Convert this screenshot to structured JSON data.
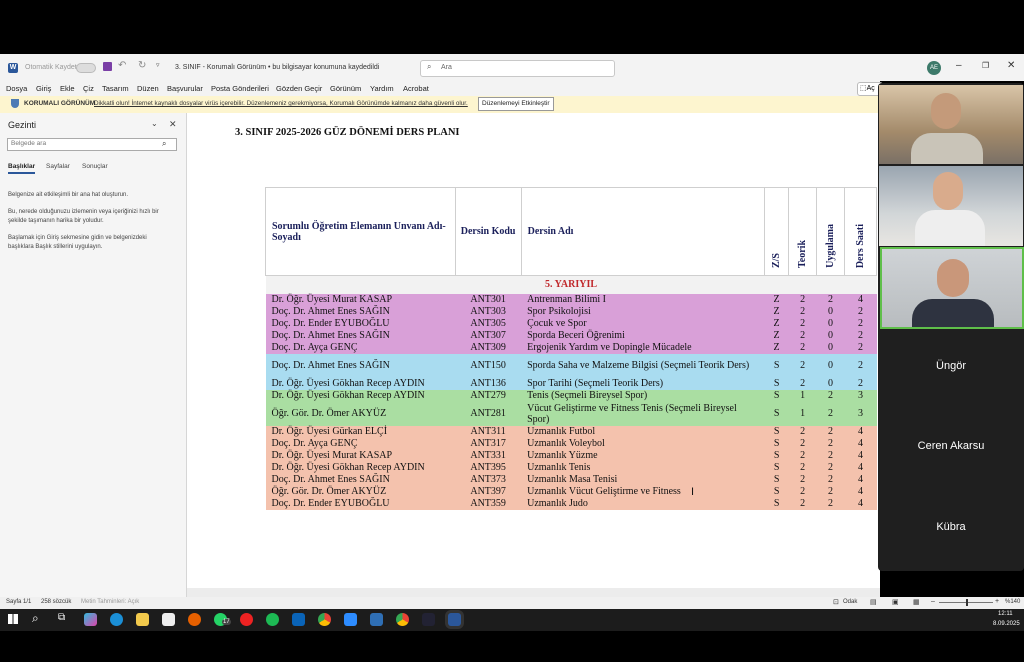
{
  "window": {
    "autosave_label": "Otomatik Kaydet",
    "doc_title": "3. SINIF - Korumalı Görünüm • bu bilgisayar konumuna kaydedildi",
    "search_placeholder": "Ara",
    "avatar_initials": "AE",
    "share_partial": "Aç"
  },
  "menu": [
    "Dosya",
    "Giriş",
    "Ekle",
    "Çiz",
    "Tasarım",
    "Düzen",
    "Başvurular",
    "Posta Gönderileri",
    "Gözden Geçir",
    "Görünüm",
    "Yardım",
    "Acrobat"
  ],
  "banner": {
    "label": "KORUMALI GÖRÜNÜM",
    "message": "Dikkatli olun! İnternet kaynaklı dosyalar virüs içerebilir. Düzenlemeniz gerekmiyorsa, Korumalı Görünümde kalmanız daha güvenli olur.",
    "button": "Düzenlemeyi Etkinleştir"
  },
  "nav": {
    "title": "Gezinti",
    "search_placeholder": "Belgede ara",
    "tabs": [
      "Başlıklar",
      "Sayfalar",
      "Sonuçlar"
    ],
    "p1": "Belgenize ait etkileşimli bir ana hat oluşturun.",
    "p2": "Bu, nerede olduğunuzu izlemenin veya içeriğinizi hızlı bir şekilde taşımanın harika bir yoludur.",
    "p3": "Başlamak için Giriş sekmesine gidin ve belgenizdeki başlıklara Başlık stillerini uygulayın."
  },
  "document": {
    "title": "3. SINIF 2025-2026 GÜZ DÖNEMİ DERS PLANI",
    "headers": {
      "instructor": "Sorumlu Öğretim Elemanın Unvanı Adı-Soyadı",
      "code": "Dersin Kodu",
      "name": "Dersin Adı",
      "zs": "Z/S",
      "theory": "Teorik",
      "practice": "Uygulama",
      "hours": "Ders Saati"
    },
    "semester": "5. YARIYIL",
    "rows": [
      {
        "instructor": "Dr. Öğr. Üyesi Murat KASAP",
        "code": "ANT301",
        "name": "Antrenman Bilimi I",
        "zs": "Z",
        "t": "2",
        "u": "2",
        "h": "4",
        "color": "pink"
      },
      {
        "instructor": "Doç. Dr. Ahmet Enes SAĞIN",
        "code": "ANT303",
        "name": "Spor Psikolojisi",
        "zs": "Z",
        "t": "2",
        "u": "0",
        "h": "2",
        "color": "pink"
      },
      {
        "instructor": "Doç. Dr. Ender EYUBOĞLU",
        "code": "ANT305",
        "name": "Çocuk ve Spor",
        "zs": "Z",
        "t": "2",
        "u": "0",
        "h": "2",
        "color": "pink"
      },
      {
        "instructor": "Doç. Dr. Ahmet Enes SAĞIN",
        "code": "ANT307",
        "name": "Sporda Beceri Öğrenimi",
        "zs": "Z",
        "t": "2",
        "u": "0",
        "h": "2",
        "color": "pink"
      },
      {
        "instructor": "Doç. Dr. Ayça GENÇ",
        "code": "ANT309",
        "name": "Ergojenik Yardım ve Dopingle Mücadele",
        "zs": "Z",
        "t": "2",
        "u": "0",
        "h": "2",
        "color": "pink"
      },
      {
        "instructor": "Doç. Dr. Ahmet Enes SAĞIN",
        "code": "ANT150",
        "name": "Sporda Saha ve Malzeme Bilgisi (Seçmeli Teorik Ders)",
        "zs": "S",
        "t": "2",
        "u": "0",
        "h": "2",
        "color": "blue"
      },
      {
        "instructor": "Dr. Öğr. Üyesi Gökhan Recep AYDIN",
        "code": "ANT136",
        "name": "Spor Tarihi (Seçmeli Teorik Ders)",
        "zs": "S",
        "t": "2",
        "u": "0",
        "h": "2",
        "color": "blue"
      },
      {
        "instructor": "Dr. Öğr. Üyesi Gökhan Recep AYDIN",
        "code": "ANT279",
        "name": "Tenis (Seçmeli Bireysel Spor)",
        "zs": "S",
        "t": "1",
        "u": "2",
        "h": "3",
        "color": "green"
      },
      {
        "instructor": "Öğr. Gör. Dr. Ömer AKYÜZ",
        "code": "ANT281",
        "name": "Vücut Geliştirme ve Fitness Tenis (Seçmeli Bireysel Spor)",
        "zs": "S",
        "t": "1",
        "u": "2",
        "h": "3",
        "color": "green"
      },
      {
        "instructor": "Dr. Öğr. Üyesi Gürkan ELÇİ",
        "code": "ANT311",
        "name": "Uzmanlık Futbol",
        "zs": "S",
        "t": "2",
        "u": "2",
        "h": "4",
        "color": "salmon"
      },
      {
        "instructor": "Doç. Dr. Ayça GENÇ",
        "code": "ANT317",
        "name": "Uzmanlık Voleybol",
        "zs": "S",
        "t": "2",
        "u": "2",
        "h": "4",
        "color": "salmon"
      },
      {
        "instructor": "Dr. Öğr. Üyesi Murat KASAP",
        "code": "ANT331",
        "name": "Uzmanlık Yüzme",
        "zs": "S",
        "t": "2",
        "u": "2",
        "h": "4",
        "color": "salmon"
      },
      {
        "instructor": "Dr. Öğr. Üyesi Gökhan Recep AYDIN",
        "code": "ANT395",
        "name": "Uzmanlık Tenis",
        "zs": "S",
        "t": "2",
        "u": "2",
        "h": "4",
        "color": "salmon"
      },
      {
        "instructor": "Doç. Dr. Ahmet Enes SAĞIN",
        "code": "ANT373",
        "name": "Uzmanlık Masa Tenisi",
        "zs": "S",
        "t": "2",
        "u": "2",
        "h": "4",
        "color": "salmon"
      },
      {
        "instructor": "Öğr. Gör. Dr. Ömer AKYÜZ",
        "code": "ANT397",
        "name": "Uzmanlık Vücut Geliştirme ve Fitness",
        "zs": "S",
        "t": "2",
        "u": "2",
        "h": "4",
        "color": "salmon"
      },
      {
        "instructor": "Doç. Dr. Ender EYUBOĞLU",
        "code": "ANT359",
        "name": "Uzmanlık Judo",
        "zs": "S",
        "t": "2",
        "u": "2",
        "h": "4",
        "color": "salmon"
      }
    ]
  },
  "status": {
    "page": "Sayfa 1/1",
    "words": "258 sözcük",
    "accessibility": "Metin Tahminleri: Açık",
    "focus": "Odak",
    "zoom": "%140"
  },
  "taskbar": {
    "time": "12:11",
    "date": "8.09.2025",
    "whatsapp_badge": "17"
  },
  "participants": [
    "Üngör",
    "Ceren Akarsu",
    "Kübra"
  ]
}
